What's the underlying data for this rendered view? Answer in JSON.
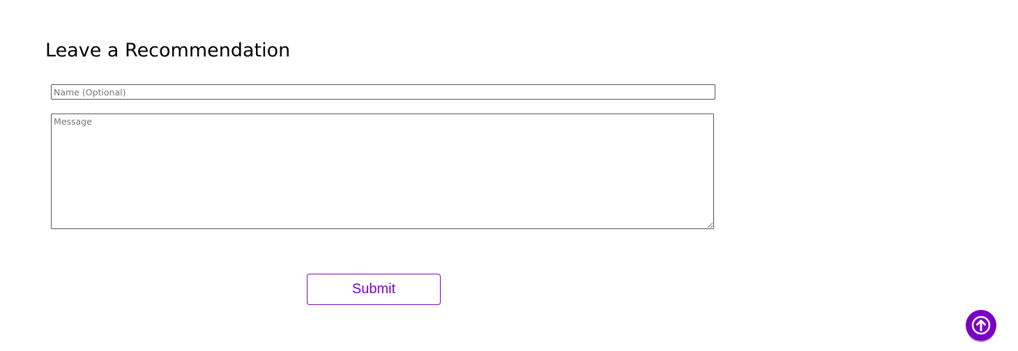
{
  "section": {
    "heading": "Leave a Recommendation"
  },
  "form": {
    "name_placeholder": "Name (Optional)",
    "name_value": "",
    "message_placeholder": "Message",
    "message_value": "",
    "submit_label": "Submit"
  },
  "scroll_top": {
    "icon": "arrow-up-icon"
  },
  "colors": {
    "accent": "#7a00c4",
    "text": "#000000",
    "placeholder": "#757575",
    "border": "#555555",
    "background": "#ffffff"
  }
}
